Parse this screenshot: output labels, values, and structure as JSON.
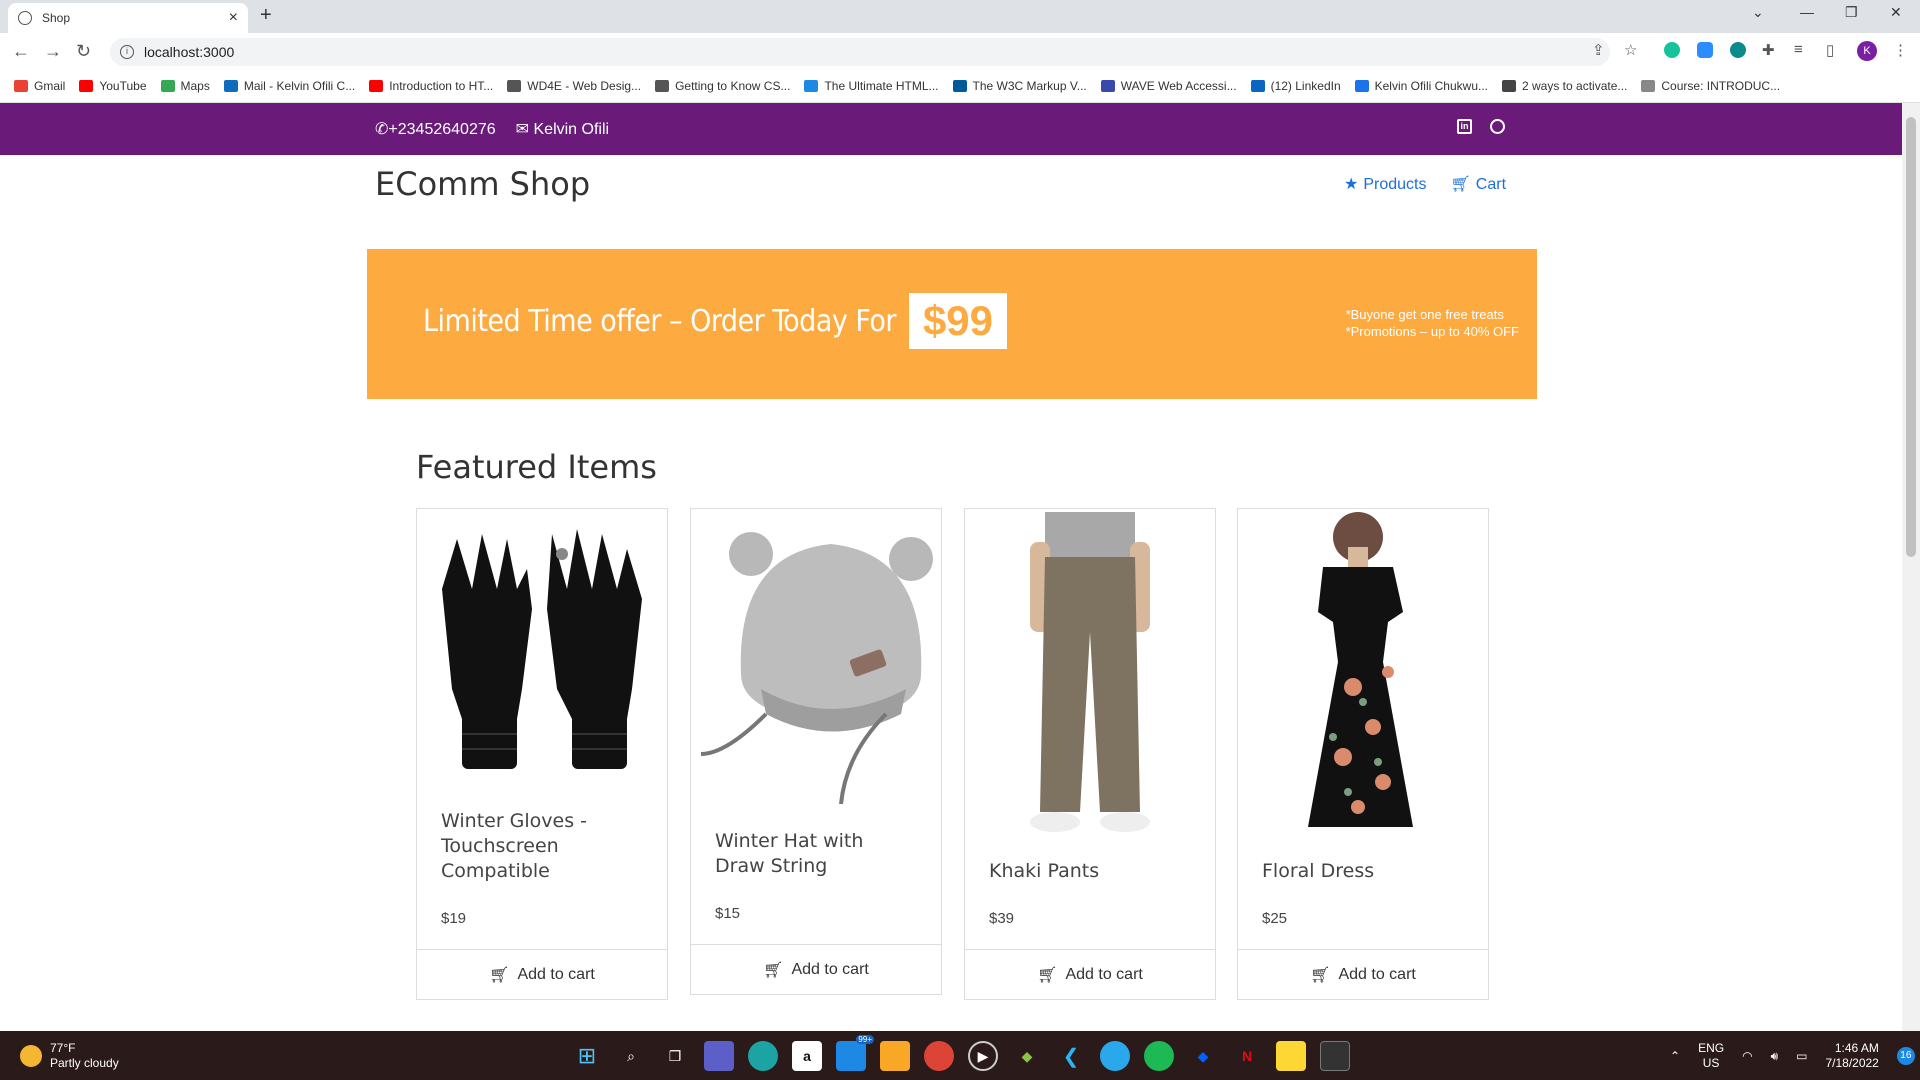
{
  "browser": {
    "tab_title": "Shop",
    "url": "localhost:3000",
    "bookmarks": [
      {
        "label": "Gmail",
        "color": "#ea4335"
      },
      {
        "label": "YouTube",
        "color": "#ff0000"
      },
      {
        "label": "Maps",
        "color": "#34a853"
      },
      {
        "label": "Mail - Kelvin Ofili C...",
        "color": "#0f6cbd"
      },
      {
        "label": "Introduction to HT...",
        "color": "#ff0000"
      },
      {
        "label": "WD4E - Web Desig...",
        "color": "#555555"
      },
      {
        "label": "Getting to Know CS...",
        "color": "#555555"
      },
      {
        "label": "The Ultimate HTML...",
        "color": "#1e88e5"
      },
      {
        "label": "The W3C Markup V...",
        "color": "#005a9c"
      },
      {
        "label": "WAVE Web Accessi...",
        "color": "#3949ab"
      },
      {
        "label": "(12) LinkedIn",
        "color": "#0a66c2"
      },
      {
        "label": "Kelvin Ofili Chukwu...",
        "color": "#1a73e8"
      },
      {
        "label": "2 ways to activate...",
        "color": "#444444"
      },
      {
        "label": "Course: INTRODUC...",
        "color": "#888888"
      }
    ],
    "profile_initial": "K"
  },
  "topbar": {
    "phone": "+23452640276",
    "email_name": "Kelvin Ofili",
    "accent": "#6a1b7a"
  },
  "header": {
    "logo": "EComm Shop",
    "nav": [
      {
        "label": "Products",
        "icon": "star-icon"
      },
      {
        "label": "Cart",
        "icon": "cart-icon"
      }
    ]
  },
  "banner": {
    "offer": "Limited Time offer – Order Today For",
    "price": "$99",
    "note1": "*Buyone get one free treats",
    "note2": "*Promotions – up to 40% OFF",
    "color": "#fdaa40"
  },
  "featured": {
    "heading": "Featured Items",
    "items": [
      {
        "title": "Winter Gloves - Touchscreen Compatible",
        "price": "$19",
        "button": "Add to cart"
      },
      {
        "title": "Winter Hat with Draw String",
        "price": "$15",
        "button": "Add to cart"
      },
      {
        "title": "Khaki Pants",
        "price": "$39",
        "button": "Add to cart"
      },
      {
        "title": "Floral Dress",
        "price": "$25",
        "button": "Add to cart"
      }
    ]
  },
  "taskbar": {
    "temp": "77°F",
    "weather": "Partly cloudy",
    "lang1": "ENG",
    "lang2": "US",
    "time": "1:46 AM",
    "date": "7/18/2022",
    "mail_badge": "99+",
    "notif_count": "16"
  }
}
